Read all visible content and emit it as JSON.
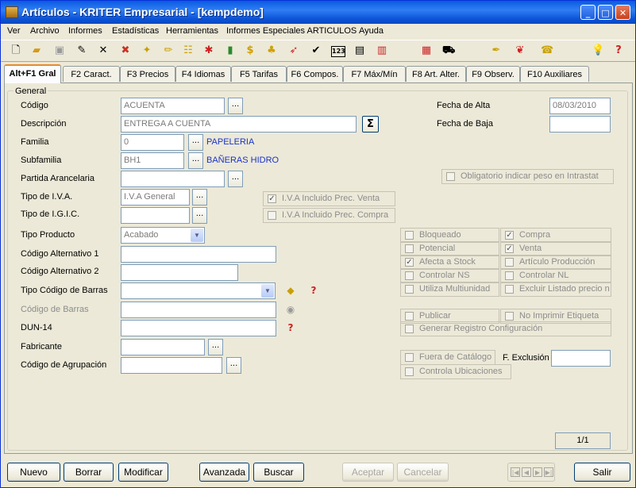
{
  "window": {
    "title": "Artículos - KRITER Empresarial - [kempdemo]"
  },
  "menu": [
    "Ver",
    "Archivo",
    "Informes",
    "Estadísticas",
    "Herramientas",
    "Informes Especiales ARTICULOS",
    "Ayuda"
  ],
  "toolbar_icons": [
    "new-icon",
    "open-icon",
    "save-icon",
    "edit-icon",
    "delete-icon",
    "tools-icon",
    "star-icon",
    "pencil-icon",
    "tree-icon",
    "asterisk-icon",
    "box-icon",
    "dollar-icon",
    "stamp-icon",
    "wand-icon",
    "check-icon",
    "number-icon",
    "print-icon",
    "chart-icon",
    "calculator-icon",
    "cart-icon",
    "pen-icon",
    "money-bag-icon",
    "phone-icon",
    "bulb-icon",
    "help-icon"
  ],
  "tabs": [
    "Alt+F1 Gral",
    "F2 Caract.",
    "F3 Precios",
    "F4 Idiomas",
    "F5 Tarifas",
    "F6 Compos.",
    "F7 Máx/Mín",
    "F8 Art. Alter.",
    "F9 Observ.",
    "F10 Auxiliares"
  ],
  "group_label": "General",
  "labels": {
    "codigo": "Código",
    "descripcion": "Descripción",
    "familia": "Familia",
    "subfamilia": "Subfamilia",
    "partida": "Partida Arancelaria",
    "tipo_iva": "Tipo de I.V.A.",
    "tipo_igic": "Tipo de I.G.I.C.",
    "tipo_producto": "Tipo Producto",
    "cod_alt1": "Código Alternativo 1",
    "cod_alt2": "Código Alternativo 2",
    "tipo_cod_barras": "Tipo Código de Barras",
    "cod_barras": "Código de Barras",
    "dun14": "DUN-14",
    "fabricante": "Fabricante",
    "cod_agrupacion": "Código de Agrupación",
    "fecha_alta": "Fecha de Alta",
    "fecha_baja": "Fecha de Baja",
    "f_exclusion": "F. Exclusión"
  },
  "values": {
    "codigo": "ACUENTA",
    "descripcion": "ENTREGA A CUENTA",
    "familia": "0",
    "familia_name": "PAPELERIA",
    "subfamilia": "BH1",
    "subfamilia_name": "BAÑERAS HIDRO",
    "tipo_iva": "I.V.A General",
    "tipo_producto": "Acabado",
    "fecha_alta": "08/03/2010",
    "fecha_baja": ""
  },
  "browse_label": "...",
  "sigma_label": "Σ",
  "checkboxes": {
    "obligatorio_peso": {
      "label": "Obligatorio indicar peso en Intrastat",
      "checked": false
    },
    "iva_incl_venta": {
      "label": "I.V.A Incluido Prec. Venta",
      "checked": true
    },
    "iva_incl_compra": {
      "label": "I.V.A Incluido Prec. Compra",
      "checked": false
    },
    "bloqueado": {
      "label": "Bloqueado",
      "checked": false
    },
    "potencial": {
      "label": "Potencial",
      "checked": false
    },
    "afecta_stock": {
      "label": "Afecta a Stock",
      "checked": true
    },
    "controlar_ns": {
      "label": "Controlar NS",
      "checked": false
    },
    "utiliza_multiunidad": {
      "label": "Utiliza Multiunidad",
      "checked": false
    },
    "compra": {
      "label": "Compra",
      "checked": true
    },
    "venta": {
      "label": "Venta",
      "checked": true
    },
    "articulo_produccion": {
      "label": "Artículo Producción",
      "checked": false
    },
    "controlar_nl": {
      "label": "Controlar NL",
      "checked": false
    },
    "excluir_listado": {
      "label": "Excluir Listado precio n",
      "checked": false
    },
    "publicar": {
      "label": "Publicar",
      "checked": false
    },
    "no_imprimir_etiqueta": {
      "label": "No Imprimir Etiqueta",
      "checked": false
    },
    "generar_registro": {
      "label": "Generar Registro Configuración",
      "checked": false
    },
    "fuera_catalogo": {
      "label": "Fuera de Catálogo",
      "checked": false
    },
    "controla_ubicaciones": {
      "label": "Controla Ubicaciones",
      "checked": false
    }
  },
  "check_mark": "✓",
  "record_counter": "1/1",
  "buttons": {
    "nuevo": "Nuevo",
    "borrar": "Borrar",
    "modificar": "Modificar",
    "avanzada": "Avanzada",
    "buscar": "Buscar",
    "aceptar": "Aceptar",
    "cancelar": "Cancelar",
    "salir": "Salir"
  },
  "colors": {
    "link_blue": "#1a33c8",
    "title_blue": "#0a5ae0",
    "active_tab_accent": "#e68b2c"
  }
}
